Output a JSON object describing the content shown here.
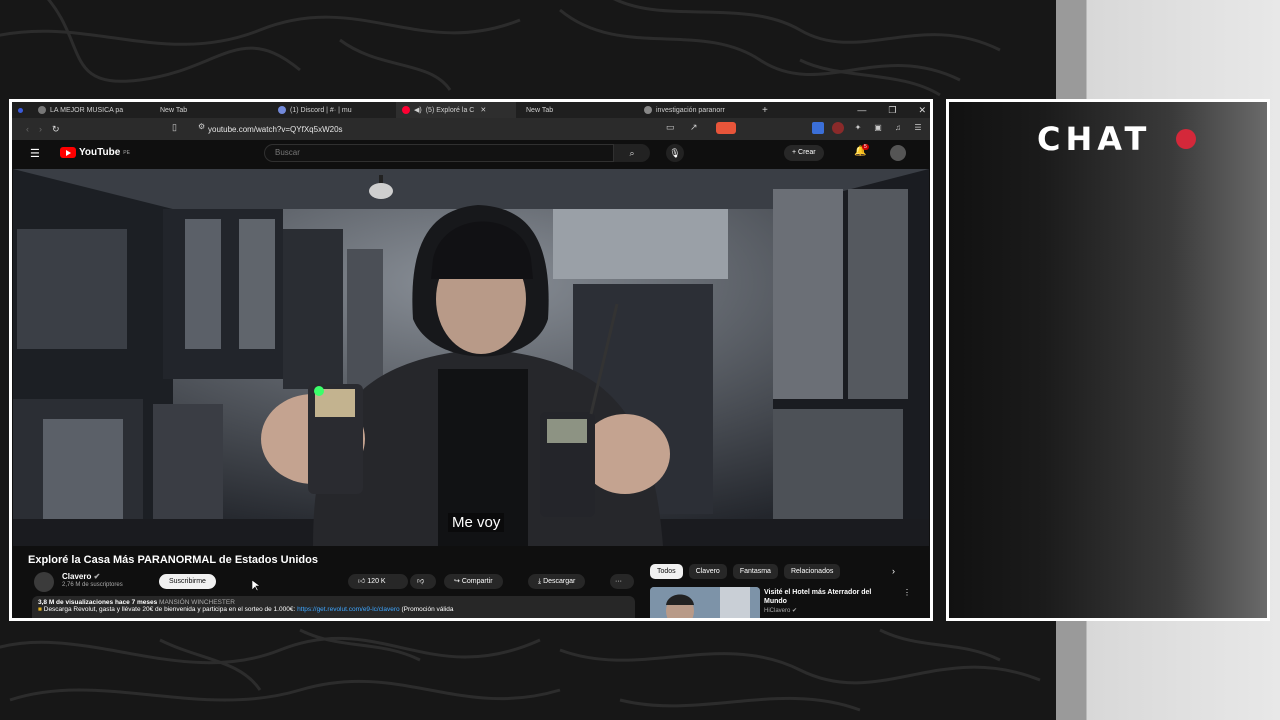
{
  "browser": {
    "tabs": [
      {
        "label": "LA MEJOR MUSICA pa",
        "icon": "music-icon"
      },
      {
        "label": "New Tab",
        "icon": ""
      },
      {
        "label": "(1) Discord | #· | mu",
        "icon": "discord-icon"
      },
      {
        "label": "(5) Exploré la C",
        "icon": "youtube-icon",
        "active": true
      },
      {
        "label": "New Tab",
        "icon": ""
      },
      {
        "label": "investigación paranorr",
        "icon": "globe-icon"
      }
    ],
    "new_tab": "+",
    "url": "youtube.com/watch?v=QYfXq5xW20s"
  },
  "youtube": {
    "logo_text": "YouTube",
    "region": "PE",
    "search_placeholder": "Buscar",
    "create_label": "Crear",
    "notification_count": "5"
  },
  "video": {
    "subtitle": "Me voy",
    "title": "Exploré la Casa Más PARANORMAL de Estados Unidos",
    "channel": "Clavero",
    "subscribers": "2,76 M de suscriptores",
    "subscribe_label": "Suscribirme",
    "likes": "120 K",
    "share_label": "Compartir",
    "download_label": "Descargar",
    "more_label": "···",
    "views_line": "3,8 M de visualizaciones  hace 7 meses",
    "tag": "MANSIÓN WINCHESTER",
    "description": "Descarga Revolut, gasta y llévate 20€ de bienvenida y participa en el sorteo de 1.000€: ",
    "link": "https://get.revolut.com/e9-lc/clavero",
    "description_tail": " (Promoción válida"
  },
  "sidebar": {
    "chips": [
      "Todos",
      "Clavero",
      "Fantasma",
      "Relacionados"
    ],
    "next": "›",
    "rec_title": "Visité el Hotel más Aterrador del Mundo",
    "rec_channel": "HiClavero"
  },
  "chat": {
    "title": "CHAT",
    "dot_color": "#d4283a"
  }
}
